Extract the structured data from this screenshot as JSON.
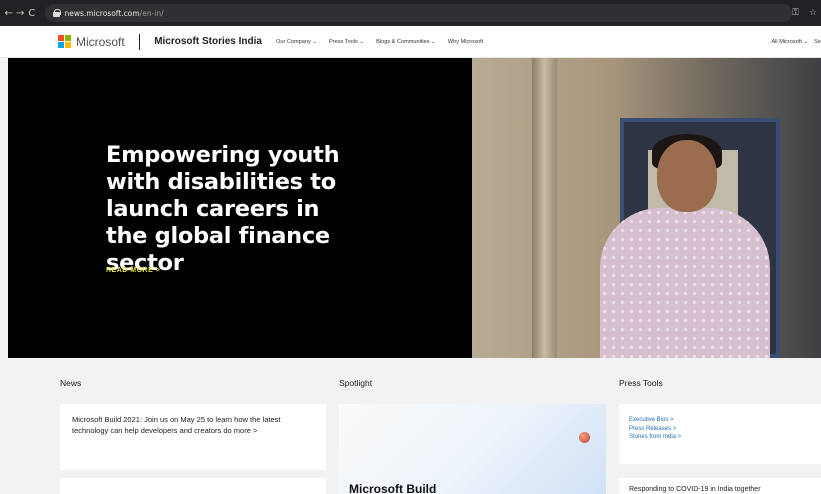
{
  "browser": {
    "back": "←",
    "forward": "→",
    "reload": "C",
    "url_host": "news.microsoft.com",
    "url_path": "/en-in/",
    "icons": [
      "key-icon",
      "star-icon"
    ],
    "key_glyph": "⚿",
    "star_glyph": "☆"
  },
  "header": {
    "logo_text": "Microsoft",
    "site_title": "Microsoft Stories India",
    "nav": [
      {
        "label": "Our Company ⌄"
      },
      {
        "label": "Press Tools ⌄"
      },
      {
        "label": "Blogs & Communities ⌄"
      },
      {
        "label": "Why Microsoft"
      }
    ],
    "all_microsoft": "All Microsoft ⌄",
    "search_partial": "Se"
  },
  "hero": {
    "title": "Empowering youth with disabilities to launch careers in the global finance sector",
    "read_more": "READ MORE >"
  },
  "sections": {
    "news": {
      "title": "News",
      "item1": "Microsoft Build 2021: Join us on May 25 to learn how the latest technology can help developers and creators do more >"
    },
    "spotlight": {
      "title": "Spotlight",
      "card_title": "Microsoft Build"
    },
    "press_tools": {
      "title": "Press Tools",
      "links": [
        "Executive Bios >",
        "Press Releases >",
        "Stories from India >"
      ],
      "item2": "Responding to COVID-19 in India together"
    }
  },
  "colors": {
    "accent_read_more": "#e3e34a",
    "link_blue": "#1f6fbf",
    "hero_bg": "#000000"
  }
}
